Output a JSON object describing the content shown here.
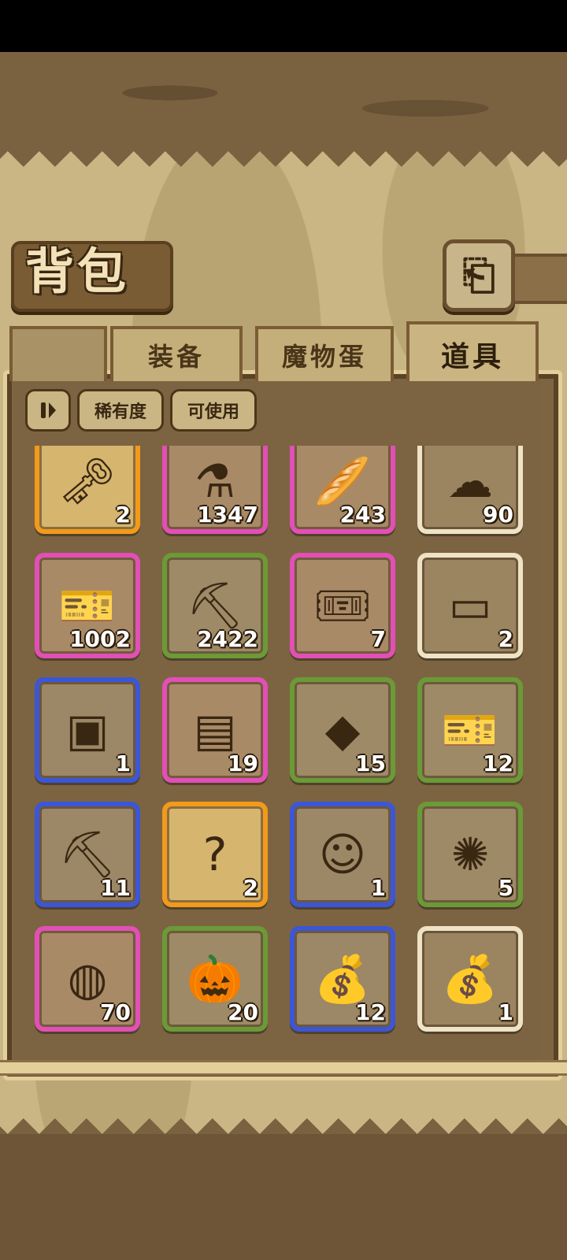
{
  "header": {
    "title": "背包",
    "back_glyph": "⎗"
  },
  "tabs": [
    {
      "label": "装备",
      "active": false
    },
    {
      "label": "魔物蛋",
      "active": false
    },
    {
      "label": "道具",
      "active": true
    }
  ],
  "filters": {
    "sort_icon": "pause-sort-icon",
    "rarity_label": "稀有度",
    "usable_label": "可使用"
  },
  "items": [
    {
      "name": "golden-key",
      "icon": "🗝",
      "qty": "2",
      "rarity": "orange"
    },
    {
      "name": "purple-potion",
      "icon": "⚗",
      "qty": "1347",
      "rarity": "pink"
    },
    {
      "name": "bread-basket",
      "icon": "🥖",
      "qty": "243",
      "rarity": "pink"
    },
    {
      "name": "green-slime",
      "icon": "☁",
      "qty": "90",
      "rarity": "white"
    },
    {
      "name": "anvil-ticket",
      "icon": "🎫",
      "qty": "1002",
      "rarity": "pink"
    },
    {
      "name": "pickaxe",
      "icon": "⛏",
      "qty": "2422",
      "rarity": "green"
    },
    {
      "name": "pink-coupon",
      "icon": "🎟",
      "qty": "7",
      "rarity": "pink"
    },
    {
      "name": "wooden-chest",
      "icon": "▭",
      "qty": "2",
      "rarity": "white"
    },
    {
      "name": "blue-chest",
      "icon": "▣",
      "qty": "1",
      "rarity": "blue"
    },
    {
      "name": "rainbow-popsicle",
      "icon": "▤",
      "qty": "19",
      "rarity": "pink"
    },
    {
      "name": "green-crystals",
      "icon": "◆",
      "qty": "15",
      "rarity": "green"
    },
    {
      "name": "character-ticket",
      "icon": "🎫",
      "qty": "12",
      "rarity": "green"
    },
    {
      "name": "iron-pickaxe",
      "icon": "⛏",
      "qty": "11",
      "rarity": "blue"
    },
    {
      "name": "mystery-silhouette",
      "icon": "?",
      "qty": "2",
      "rarity": "orange"
    },
    {
      "name": "portrait-puzzle",
      "icon": "☺",
      "qty": "1",
      "rarity": "blue"
    },
    {
      "name": "mooncake",
      "icon": "✺",
      "qty": "5",
      "rarity": "green"
    },
    {
      "name": "ham-slices",
      "icon": "◍",
      "qty": "70",
      "rarity": "pink"
    },
    {
      "name": "pumpkin-ticket",
      "icon": "🎃",
      "qty": "20",
      "rarity": "green"
    },
    {
      "name": "gold-sack",
      "icon": "💰",
      "qty": "12",
      "rarity": "blue"
    },
    {
      "name": "small-sack",
      "icon": "💰",
      "qty": "1",
      "rarity": "white"
    }
  ]
}
